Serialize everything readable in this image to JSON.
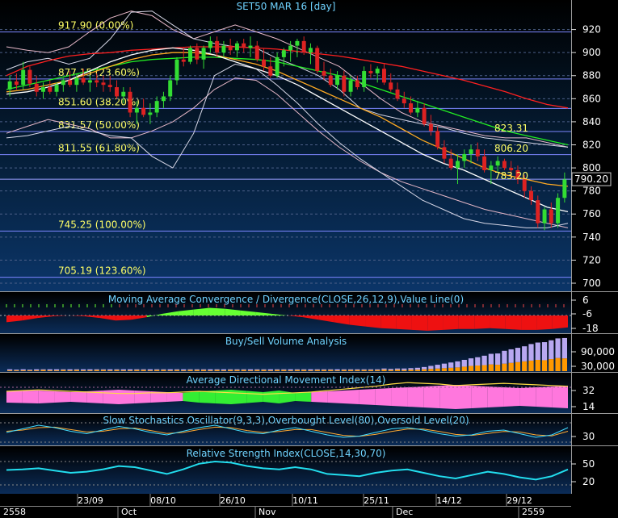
{
  "chart_data": [
    {
      "type": "line",
      "title": "SET50 MAR 16   [day]",
      "ylim": [
        693,
        940
      ],
      "yticks": [
        920,
        900,
        880,
        860,
        840,
        820,
        800,
        780,
        760,
        740,
        720,
        700
      ],
      "current_price": "790.20",
      "fib_levels": [
        {
          "label": "917.90 (0.00%)",
          "value": 917.9
        },
        {
          "label": "877.15 (23.60%)",
          "value": 877.15
        },
        {
          "label": "851.60 (38.20%)",
          "value": 851.6
        },
        {
          "label": "831.57 (50.00%)",
          "value": 831.57
        },
        {
          "label": "811.55 (61.80%)",
          "value": 811.55
        },
        {
          "label": "745.25 (100.00%)",
          "value": 745.25
        },
        {
          "label": "705.19 (123.60%)",
          "value": 705.19
        }
      ],
      "price_labels": [
        "823.31",
        "806.20",
        "783.20"
      ],
      "candles": [
        [
          868,
          880,
          862,
          875
        ],
        [
          875,
          882,
          868,
          872
        ],
        [
          872,
          892,
          868,
          885
        ],
        [
          885,
          888,
          870,
          873
        ],
        [
          873,
          880,
          862,
          866
        ],
        [
          866,
          874,
          860,
          870
        ],
        [
          870,
          876,
          864,
          866
        ],
        [
          866,
          874,
          862,
          872
        ],
        [
          872,
          878,
          866,
          876
        ],
        [
          876,
          884,
          870,
          872
        ],
        [
          872,
          882,
          866,
          878
        ],
        [
          878,
          886,
          872,
          874
        ],
        [
          874,
          880,
          866,
          876
        ],
        [
          876,
          882,
          870,
          874
        ],
        [
          874,
          880,
          866,
          872
        ],
        [
          872,
          880,
          866,
          870
        ],
        [
          870,
          876,
          860,
          862
        ],
        [
          862,
          870,
          856,
          866
        ],
        [
          866,
          870,
          844,
          848
        ],
        [
          848,
          858,
          838,
          852
        ],
        [
          852,
          860,
          844,
          846
        ],
        [
          846,
          856,
          838,
          848
        ],
        [
          848,
          862,
          844,
          858
        ],
        [
          858,
          866,
          852,
          862
        ],
        [
          862,
          880,
          858,
          876
        ],
        [
          876,
          896,
          872,
          894
        ],
        [
          894,
          904,
          888,
          892
        ],
        [
          892,
          906,
          890,
          904
        ],
        [
          904,
          908,
          890,
          894
        ],
        [
          894,
          906,
          886,
          904
        ],
        [
          904,
          914,
          900,
          910
        ],
        [
          910,
          914,
          896,
          900
        ],
        [
          900,
          910,
          896,
          906
        ],
        [
          906,
          912,
          898,
          902
        ],
        [
          902,
          910,
          896,
          908
        ],
        [
          908,
          912,
          900,
          904
        ],
        [
          904,
          914,
          896,
          906
        ],
        [
          906,
          910,
          892,
          894
        ],
        [
          894,
          904,
          884,
          888
        ],
        [
          888,
          896,
          878,
          880
        ],
        [
          880,
          900,
          878,
          896
        ],
        [
          896,
          904,
          888,
          902
        ],
        [
          902,
          910,
          892,
          906
        ],
        [
          906,
          912,
          896,
          910
        ],
        [
          910,
          914,
          898,
          900
        ],
        [
          900,
          908,
          890,
          904
        ],
        [
          904,
          906,
          882,
          884
        ],
        [
          884,
          892,
          876,
          880
        ],
        [
          880,
          886,
          870,
          872
        ],
        [
          872,
          884,
          868,
          880
        ],
        [
          880,
          884,
          862,
          866
        ],
        [
          866,
          880,
          862,
          876
        ],
        [
          876,
          880,
          868,
          870
        ],
        [
          870,
          888,
          866,
          884
        ],
        [
          884,
          890,
          878,
          882
        ],
        [
          882,
          888,
          874,
          886
        ],
        [
          886,
          890,
          872,
          874
        ],
        [
          874,
          882,
          866,
          868
        ],
        [
          868,
          874,
          858,
          860
        ],
        [
          860,
          866,
          852,
          856
        ],
        [
          856,
          862,
          846,
          848
        ],
        [
          848,
          858,
          844,
          852
        ],
        [
          852,
          856,
          836,
          838
        ],
        [
          838,
          846,
          828,
          832
        ],
        [
          832,
          836,
          816,
          818
        ],
        [
          818,
          824,
          804,
          808
        ],
        [
          808,
          816,
          798,
          800
        ],
        [
          800,
          812,
          786,
          806
        ],
        [
          806,
          816,
          800,
          812
        ],
        [
          812,
          820,
          804,
          816
        ],
        [
          816,
          822,
          806,
          810
        ],
        [
          810,
          816,
          796,
          798
        ],
        [
          798,
          806,
          786,
          802
        ],
        [
          802,
          810,
          796,
          806
        ],
        [
          806,
          808,
          798,
          800
        ],
        [
          800,
          806,
          790,
          798
        ],
        [
          798,
          802,
          786,
          790
        ],
        [
          790,
          794,
          774,
          780
        ],
        [
          780,
          784,
          768,
          772
        ],
        [
          772,
          776,
          748,
          752
        ],
        [
          752,
          766,
          746,
          764
        ],
        [
          764,
          770,
          748,
          752
        ],
        [
          752,
          778,
          748,
          774
        ],
        [
          774,
          796,
          770,
          790
        ]
      ],
      "ma_series": [
        {
          "color": "#ff2020",
          "values": [
            880,
            888,
            893,
            897,
            899,
            900,
            902,
            903,
            904,
            905,
            905,
            905,
            904,
            903,
            901,
            899,
            897,
            894,
            891,
            888,
            884,
            880,
            876,
            871,
            866,
            860,
            855,
            852
          ]
        },
        {
          "color": "#22ee22",
          "values": [
            868,
            872,
            876,
            880,
            884,
            888,
            892,
            894,
            895,
            896,
            896,
            895,
            894,
            892,
            888,
            884,
            880,
            874,
            868,
            862,
            856,
            850,
            844,
            838,
            832,
            828,
            824,
            820
          ]
        },
        {
          "color": "#ffaa22",
          "values": [
            866,
            868,
            872,
            876,
            882,
            888,
            894,
            898,
            900,
            900,
            898,
            894,
            890,
            884,
            876,
            868,
            860,
            852,
            844,
            834,
            824,
            816,
            808,
            800,
            794,
            790,
            786,
            784
          ]
        },
        {
          "color": "#ffffff",
          "values": [
            864,
            866,
            870,
            876,
            884,
            892,
            898,
            902,
            904,
            902,
            898,
            892,
            886,
            880,
            872,
            862,
            852,
            842,
            832,
            822,
            812,
            804,
            798,
            790,
            782,
            774,
            766,
            762
          ]
        }
      ],
      "bollinger_upper": [
        905,
        902,
        900,
        905,
        918,
        930,
        936,
        932,
        920,
        912,
        918,
        924,
        918,
        912,
        904,
        896,
        888,
        874,
        860,
        848,
        840,
        836,
        832,
        828,
        826,
        826,
        822,
        818
      ],
      "bollinger_lower": [
        830,
        836,
        842,
        838,
        834,
        826,
        826,
        832,
        840,
        852,
        868,
        878,
        876,
        864,
        848,
        832,
        818,
        806,
        796,
        788,
        782,
        776,
        770,
        764,
        760,
        756,
        752,
        748
      ],
      "envelope_upper": [
        885,
        892,
        895,
        890,
        895,
        912,
        935,
        936,
        924,
        912,
        908,
        905,
        904,
        895,
        888,
        880,
        868,
        852,
        846,
        842,
        838,
        835,
        830,
        826,
        824,
        822,
        820,
        818
      ],
      "envelope_lower": [
        826,
        828,
        832,
        836,
        832,
        828,
        826,
        810,
        800,
        830,
        880,
        890,
        886,
        872,
        856,
        838,
        822,
        808,
        796,
        784,
        772,
        764,
        756,
        752,
        750,
        748,
        748,
        752
      ]
    },
    {
      "type": "area",
      "title": "Moving Average Convergence / Divergence(CLOSE,26,12,9),Value Line(0)",
      "yticks": [
        6,
        -6,
        -18
      ],
      "macd": [
        -8,
        -6,
        -3,
        -1,
        0,
        -1,
        -3,
        -6,
        -5,
        -2,
        2,
        5,
        7,
        9,
        8,
        6,
        4,
        2,
        0,
        -2,
        -5,
        -8,
        -11,
        -13,
        -15,
        -16,
        -17,
        -18,
        -17,
        -16,
        -16,
        -15,
        -16,
        -17,
        -17,
        -16,
        -14
      ]
    },
    {
      "type": "bar",
      "title": "Buy/Sell Volume Analysis",
      "yticks": [
        "90,000",
        "30,000"
      ],
      "buy": [
        2,
        2,
        2,
        2,
        2,
        3,
        2,
        2,
        3,
        2,
        3,
        2,
        2,
        3,
        3,
        2,
        3,
        2,
        2,
        3,
        3,
        2,
        3,
        3,
        2,
        3,
        2,
        3,
        3,
        3,
        2,
        3,
        2,
        3,
        3,
        3,
        2,
        3,
        3,
        2,
        3,
        3,
        2,
        3,
        3,
        2,
        3,
        3,
        3,
        2,
        3,
        3,
        3,
        3,
        3,
        3,
        4,
        3,
        4,
        3,
        4,
        4,
        5,
        6,
        7,
        8,
        9,
        10,
        12,
        14,
        15,
        16,
        18,
        17,
        20,
        22,
        24,
        26,
        28,
        30,
        29,
        32,
        35,
        34
      ],
      "sell": [
        3,
        2,
        3,
        2,
        3,
        2,
        3,
        3,
        2,
        3,
        2,
        3,
        3,
        2,
        2,
        3,
        2,
        3,
        3,
        2,
        2,
        3,
        2,
        2,
        3,
        2,
        3,
        2,
        2,
        2,
        3,
        2,
        3,
        2,
        2,
        2,
        3,
        2,
        2,
        3,
        2,
        2,
        3,
        2,
        2,
        3,
        2,
        2,
        2,
        3,
        2,
        2,
        2,
        2,
        2,
        2,
        3,
        3,
        3,
        4,
        4,
        5,
        6,
        8,
        10,
        12,
        14,
        16,
        18,
        20,
        22,
        25,
        28,
        30,
        34,
        36,
        38,
        40,
        44,
        46,
        48,
        50,
        52,
        54
      ]
    },
    {
      "type": "area",
      "title": "Average Directional Movement Index(14)",
      "yticks": [
        32,
        14
      ],
      "dmi": [
        -14,
        -15,
        -16,
        -14,
        -12,
        -14,
        -16,
        -18,
        -16,
        -14,
        -12,
        10,
        14,
        16,
        18,
        15,
        12,
        16,
        10,
        -12,
        -14,
        -16,
        -18,
        -20,
        -22,
        -24,
        -26,
        -28,
        -30,
        -28,
        -26,
        -24,
        -22,
        -24,
        -26,
        -28
      ],
      "adx": [
        30,
        31,
        32,
        31,
        30,
        29,
        28,
        27,
        27,
        28,
        28,
        29,
        30,
        29,
        28,
        27,
        26,
        27,
        28,
        29,
        31,
        33,
        35,
        37,
        40,
        42,
        41,
        40,
        38,
        39,
        40,
        41,
        40,
        39,
        38,
        37
      ]
    },
    {
      "type": "line",
      "title": "Slow Stochastics Oscillator(9,3,3),Overbought Level(80),Oversold Level(20)",
      "yticks": [
        30
      ],
      "k": [
        40,
        55,
        70,
        60,
        45,
        35,
        50,
        65,
        55,
        40,
        30,
        45,
        60,
        70,
        55,
        40,
        35,
        50,
        60,
        45,
        30,
        20,
        25,
        40,
        55,
        60,
        50,
        35,
        25,
        30,
        45,
        50,
        35,
        20,
        30,
        60
      ],
      "d": [
        45,
        50,
        60,
        62,
        52,
        42,
        45,
        55,
        58,
        48,
        36,
        40,
        52,
        62,
        60,
        48,
        40,
        44,
        52,
        52,
        40,
        28,
        24,
        32,
        44,
        54,
        54,
        44,
        32,
        28,
        36,
        44,
        42,
        30,
        26,
        45
      ]
    },
    {
      "type": "line",
      "title": "Relative Strength Index(CLOSE,14,30,70)",
      "yticks": [
        50,
        20
      ],
      "rsi": [
        45,
        46,
        48,
        44,
        40,
        42,
        46,
        52,
        50,
        44,
        38,
        46,
        56,
        60,
        58,
        52,
        48,
        46,
        50,
        46,
        38,
        36,
        34,
        40,
        44,
        46,
        40,
        34,
        30,
        36,
        42,
        38,
        32,
        28,
        34,
        46
      ]
    }
  ],
  "x_axis": {
    "years": [
      "2558",
      "2559"
    ],
    "months": [
      "Oct",
      "Nov",
      "Dec"
    ],
    "dates": [
      "23/09",
      "08/10",
      "26/10",
      "10/11",
      "25/11",
      "14/12",
      "29/12"
    ]
  }
}
